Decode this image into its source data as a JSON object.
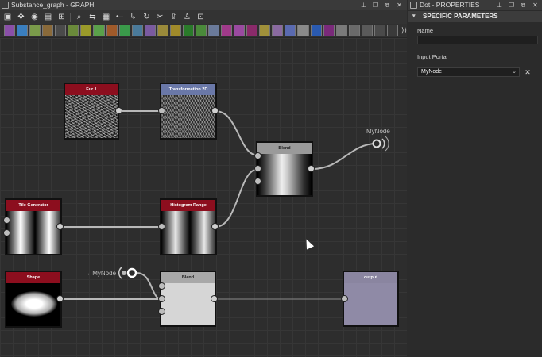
{
  "graph_window": {
    "title": "Substance_graph - GRAPH",
    "controls": [
      "pin-icon",
      "restore-icon",
      "float-icon",
      "close-icon"
    ]
  },
  "toolbar": {
    "icons": [
      "frame-icon",
      "pan-icon",
      "screenshot-icon",
      "align-icon",
      "graph-icon",
      "zoom-icon",
      "link-icon",
      "layout-icon",
      "dot-icon",
      "pin-node-icon",
      "refresh-icon",
      "tools-icon",
      "export-icon",
      "user-icon",
      "fit-icon"
    ]
  },
  "atom_bar": {
    "atoms": [
      {
        "icon": "atom-icon",
        "color": "#8a4fa8"
      },
      {
        "icon": "atom-icon",
        "color": "#3a7fc0"
      },
      {
        "icon": "atom-icon",
        "color": "#7a9b4a"
      },
      {
        "icon": "atom-icon",
        "color": "#8a6a3a"
      },
      {
        "icon": "atom-icon",
        "color": "#4a4a4a"
      },
      {
        "icon": "atom-icon",
        "color": "#6a8a3a"
      },
      {
        "icon": "atom-icon",
        "color": "#9a9a2a"
      },
      {
        "icon": "atom-icon",
        "color": "#5aa04a"
      },
      {
        "icon": "atom-icon",
        "color": "#a05a2a"
      },
      {
        "icon": "atom-icon",
        "color": "#3a9a4a"
      },
      {
        "icon": "atom-icon",
        "color": "#4a7a9a"
      },
      {
        "icon": "atom-icon",
        "color": "#7a5aa0"
      },
      {
        "icon": "atom-icon",
        "color": "#9a8a3a"
      },
      {
        "icon": "atom-icon",
        "color": "#a08a2a"
      },
      {
        "icon": "atom-icon",
        "color": "#2a7a2a"
      },
      {
        "icon": "atom-icon",
        "color": "#4a8a3a"
      },
      {
        "icon": "atom-icon",
        "color": "#6a7a9a"
      },
      {
        "icon": "atom-icon",
        "color": "#a03a8a"
      },
      {
        "icon": "atom-icon",
        "color": "#9a4aa0"
      },
      {
        "icon": "atom-icon",
        "color": "#8a2a6a"
      },
      {
        "icon": "atom-icon",
        "color": "#a0903a"
      },
      {
        "icon": "atom-icon",
        "color": "#8a6aa0"
      },
      {
        "icon": "atom-icon",
        "color": "#5a6ab0"
      },
      {
        "icon": "atom-icon",
        "color": "#8a8a8a"
      },
      {
        "icon": "atom-icon",
        "color": "#2a5ab0"
      },
      {
        "icon": "atom-icon",
        "color": "#7a2a7a"
      },
      {
        "icon": "atom-icon",
        "color": "#7a7a7a"
      },
      {
        "icon": "atom-icon",
        "color": "#6a6a6a"
      },
      {
        "icon": "atom-icon",
        "color": "#5a5a5a"
      },
      {
        "icon": "atom-icon",
        "color": "#4a4a4a"
      },
      {
        "icon": "atom-icon",
        "color": "#3a3a3a"
      }
    ],
    "tail": "⟩⟩"
  },
  "nodes": {
    "fur": {
      "title": "Fur 1",
      "header_color": "#8c0e1e"
    },
    "transform": {
      "title": "Transformation 2D",
      "header_color": "#6a78a8"
    },
    "blend_top": {
      "title": "Blend",
      "header_color": "#9a9a9a"
    },
    "tile": {
      "title": "Tile Generator",
      "header_color": "#8c0e1e"
    },
    "histogram": {
      "title": "Histogram Range",
      "header_color": "#8c0e1e"
    },
    "shape": {
      "title": "Shape",
      "header_color": "#8c0e1e"
    },
    "blend_bottom": {
      "title": "Blend",
      "header_color": "#a8a8a8"
    },
    "output": {
      "title": "output",
      "header_color": "#8a85a0"
    }
  },
  "portals": {
    "out_label": "MyNode",
    "in_label": "→ MyNode"
  },
  "properties_window": {
    "title": "Dot - PROPERTIES",
    "section": "SPECIFIC PARAMETERS",
    "name_label": "Name",
    "name_value": "",
    "portal_label": "Input Portal",
    "portal_value": "MyNode",
    "clear_glyph": "✕"
  }
}
